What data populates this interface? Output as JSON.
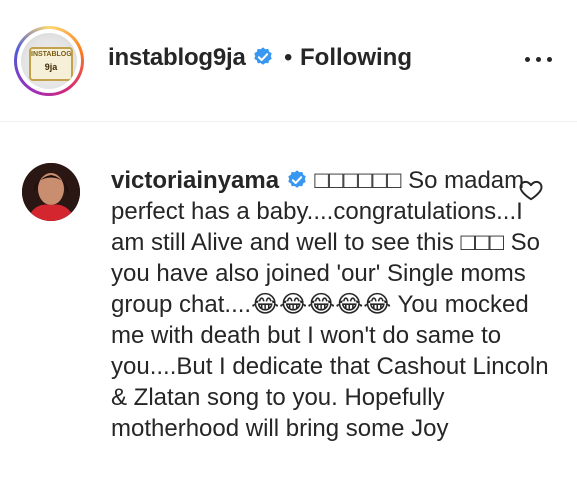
{
  "post_header": {
    "username": "instablog9ja",
    "separator": "•",
    "follow_status": "Following",
    "avatar_logo_top": "INSTABLOG",
    "avatar_logo_bottom": "9ja"
  },
  "comment": {
    "username": "victoriainyama",
    "text": " □□□□□□ So madam perfect has a baby....congratulations...I am still Alive and well to see this □□□ So you have also joined 'our' Single moms group chat....😂😂😂😂😂 You mocked me with death but I won't do same to you....But I dedicate that Cashout Lincoln & Zlatan song to you. Hopefully motherhood will bring some Joy"
  },
  "colors": {
    "verified_badge": "#3897f0",
    "text": "#262626",
    "divider": "#efefef"
  },
  "icons": {
    "verified": "verified-badge-icon",
    "more": "more-options-icon",
    "like": "heart-icon"
  }
}
